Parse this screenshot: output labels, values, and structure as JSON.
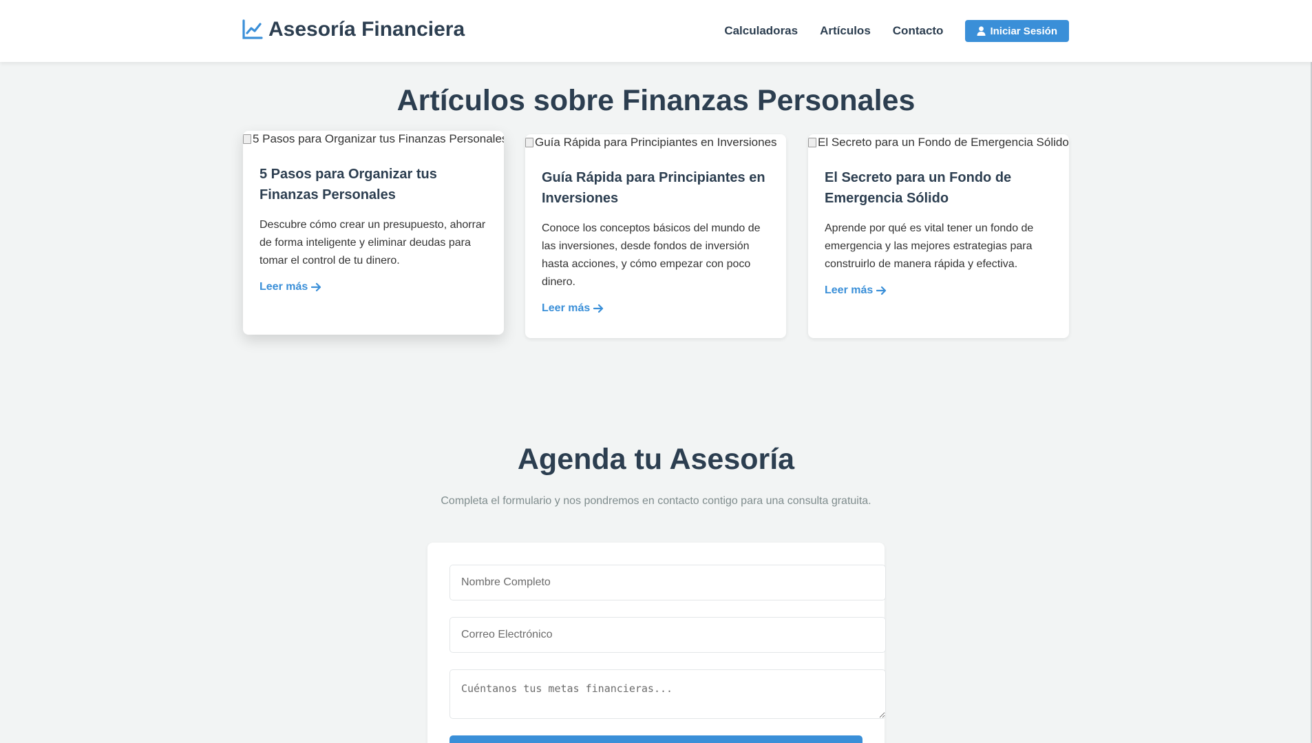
{
  "header": {
    "brand": "Asesoría Financiera",
    "brand_icon": "chart-line-icon",
    "nav": [
      "Calculadoras",
      "Artículos",
      "Contacto"
    ],
    "login_label": "Iniciar Sesión",
    "login_icon": "user-icon"
  },
  "articles": {
    "title": "Artículos sobre Finanzas Personales",
    "items": [
      {
        "image_alt": "5 Pasos para Organizar tus Finanzas Personales",
        "title": "5 Pasos para Organizar tus Finanzas Personales",
        "text": "Descubre cómo crear un presupuesto, ahorrar de forma inteligente y eliminar deudas para tomar el control de tu dinero.",
        "link": "Leer más"
      },
      {
        "image_alt": "Guía Rápida para Principiantes en Inversiones",
        "title": "Guía Rápida para Principiantes en Inversiones",
        "text": "Conoce los conceptos básicos del mundo de las inversiones, desde fondos de inversión hasta acciones, y cómo empezar con poco dinero.",
        "link": "Leer más"
      },
      {
        "image_alt": "El Secreto para un Fondo de Emergencia Sólido",
        "title": "El Secreto para un Fondo de Emergencia Sólido",
        "text": "Aprende por qué es vital tener un fondo de emergencia y las mejores estrategias para construirlo de manera rápida y efectiva.",
        "link": "Leer más"
      }
    ]
  },
  "booking": {
    "title": "Agenda tu Asesoría",
    "subtitle": "Completa el formulario y nos pondremos en contacto contigo para una consulta gratuita.",
    "name_placeholder": "Nombre Completo",
    "email_placeholder": "Correo Electrónico",
    "message_placeholder": "Cuéntanos tus metas financieras..."
  },
  "colors": {
    "accent": "#3a8fd8",
    "heading": "#2c3e50",
    "background": "#f2f4f4"
  }
}
